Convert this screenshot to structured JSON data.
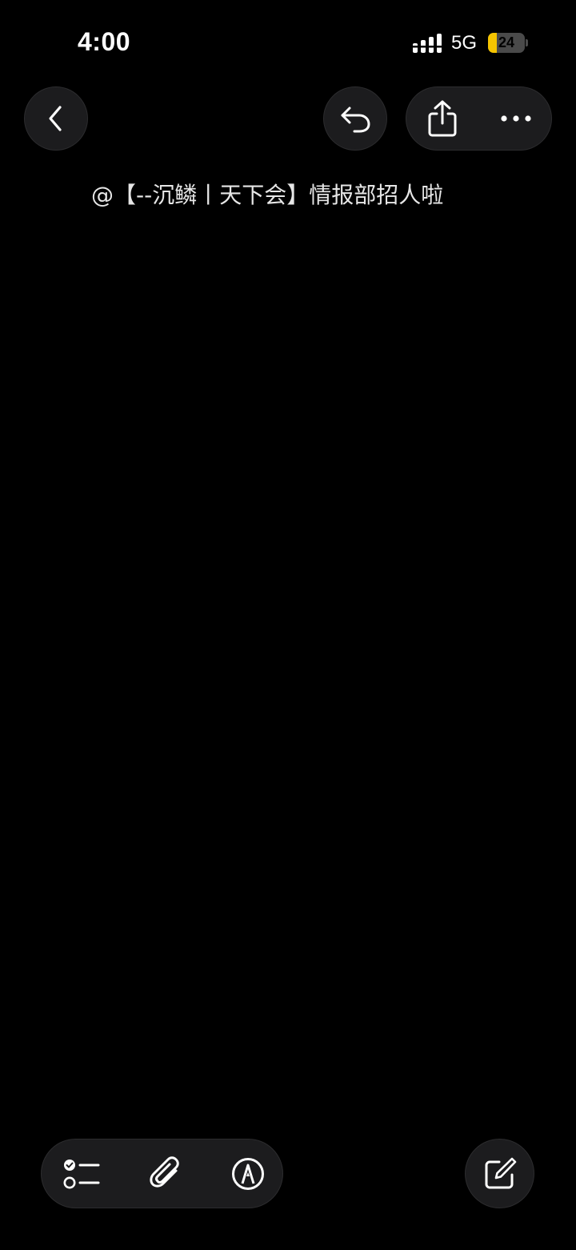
{
  "status_bar": {
    "time": "4:00",
    "network": "5G",
    "battery_level": "24",
    "battery_color": "#f5c400",
    "signal_icon": "signal-bars-icon"
  },
  "nav": {
    "back_icon": "chevron-left-icon",
    "undo_icon": "undo-arrow-icon",
    "share_icon": "share-icon",
    "more_icon": "ellipsis-icon"
  },
  "note": {
    "text": "@【--沉鳞丨天下会】情报部招人啦"
  },
  "toolbar": {
    "checklist_icon": "checklist-icon",
    "attach_icon": "paperclip-icon",
    "markup_icon": "pen-markup-icon",
    "compose_icon": "compose-icon"
  },
  "colors": {
    "background": "#000000",
    "button_bg": "#1c1c1e",
    "text": "#e6e6e6"
  }
}
